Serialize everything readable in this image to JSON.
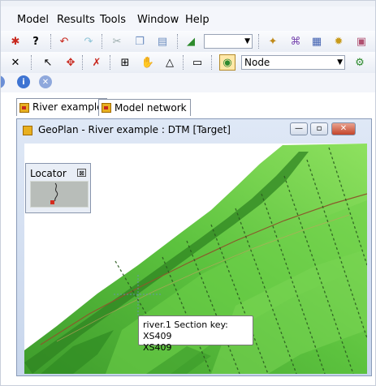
{
  "menu": {
    "items": [
      {
        "label": "Model"
      },
      {
        "label": "Results"
      },
      {
        "label": "Tools"
      },
      {
        "label": "Window"
      },
      {
        "label": "Help"
      }
    ]
  },
  "toolbar": {
    "combo1_value": "",
    "selection_mode_value": "Node"
  },
  "doc_tabs": [
    {
      "label": "River example",
      "active": true
    },
    {
      "label": "Model network",
      "active": false
    }
  ],
  "window": {
    "title": "GeoPlan - River example : DTM  [Target]",
    "minimize_glyph": "—",
    "maximize_glyph": "▫",
    "close_glyph": "✕"
  },
  "locator": {
    "title": "Locator",
    "close_glyph": "⊠"
  },
  "tooltip": {
    "line1": "river.1 Section key: XS409",
    "line2": "XS409"
  },
  "colors": {
    "terrain_dark": "#3f9f2b",
    "terrain_light": "#8ce25c",
    "river_line": "#8a5a2b",
    "accent_red": "#d42c1f"
  }
}
